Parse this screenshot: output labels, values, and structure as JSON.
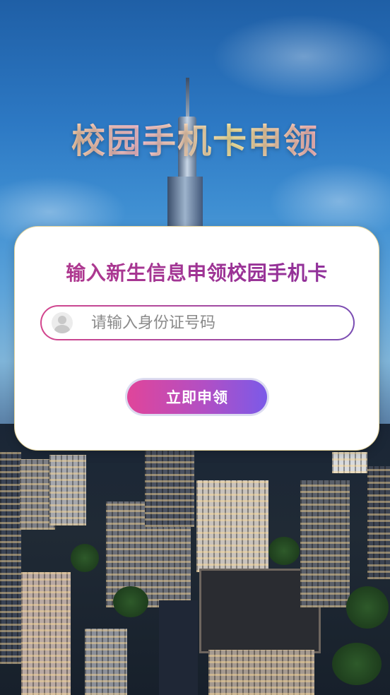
{
  "page": {
    "title": "校园手机卡申领"
  },
  "card": {
    "heading": "输入新生信息申领校园手机卡",
    "id_input": {
      "placeholder": "请输入身份证号码",
      "value": "",
      "icon": "user-avatar-icon"
    },
    "apply_button_label": "立即申领"
  },
  "colors": {
    "heading": "#9b2f8f",
    "button_gradient_start": "#e0459a",
    "button_gradient_end": "#7b5ae8",
    "field_border_start": "#d3458d",
    "field_border_end": "#7a4db3"
  }
}
